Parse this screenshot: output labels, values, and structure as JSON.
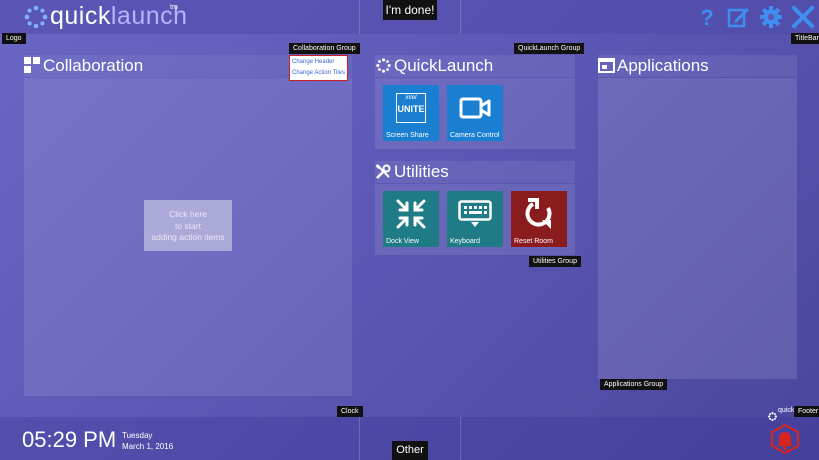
{
  "titlebar": {
    "logo_quick": "quick",
    "logo_launch": "launch",
    "logo_tm": "tm",
    "done_label": "I'm done!",
    "logo_tag": "Logo",
    "titlebar_tag": "TitleBar",
    "icons": [
      "help-icon",
      "edit-icon",
      "settings-icon",
      "close-icon"
    ]
  },
  "collaboration": {
    "title": "Collaboration",
    "group_tag": "Collaboration Group",
    "menu": [
      "Change Header",
      "Change Action Tiles"
    ],
    "placeholder_lines": [
      "Click here",
      "to start",
      "adding action items"
    ]
  },
  "quicklaunch": {
    "title": "QuickLaunch",
    "group_tag": "QuickLaunch Group",
    "tiles": [
      {
        "label": "Screen Share",
        "icon": "intel-unite-icon",
        "color": "#1a7fd1",
        "badge_top": "intel",
        "badge_main": "UNITE"
      },
      {
        "label": "Camera Control",
        "icon": "camera-icon",
        "color": "#1a7fd1"
      }
    ]
  },
  "utilities": {
    "title": "Utilities",
    "group_tag": "Utilities Group",
    "tiles": [
      {
        "label": "Dock View",
        "icon": "dock-arrows-icon",
        "color": "#1f7b86"
      },
      {
        "label": "Keyboard",
        "icon": "keyboard-icon",
        "color": "#1f7b86"
      },
      {
        "label": "Reset Room",
        "icon": "reset-icon",
        "color": "#8a1c1e"
      }
    ]
  },
  "applications": {
    "title": "Applications",
    "group_tag": "Applications Group"
  },
  "footer": {
    "time": "05:29 PM",
    "day": "Tuesday",
    "date": "March 1, 2016",
    "clock_tag": "Clock",
    "footer_tag": "Footer",
    "other_label": "Other",
    "mini_logo_text": "quick",
    "alert_icon": "alarm-bell-icon",
    "alert_color": "#d8261f"
  },
  "colors": {
    "accent": "#6a66c4",
    "tile_blue": "#1a7fd1",
    "tile_teal": "#1f7b86",
    "tile_red": "#8a1c1e"
  }
}
